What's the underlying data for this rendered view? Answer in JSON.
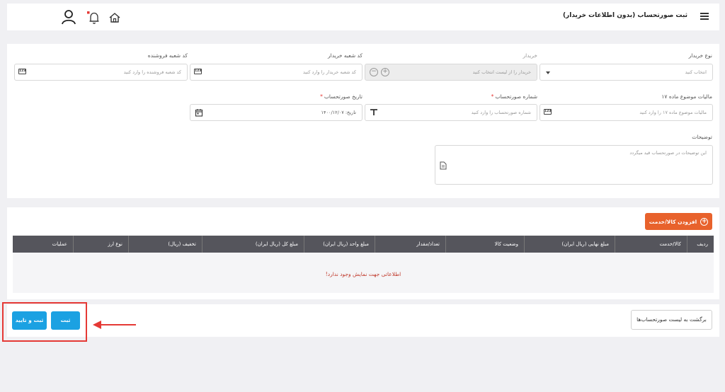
{
  "header": {
    "title": "ثبت صورتحساب (بدون اطلاعات خریدار)",
    "notification_dot_color": "#e53935"
  },
  "form": {
    "buyer_type": {
      "label": "نوع خریدار",
      "placeholder": "انتخاب کنید"
    },
    "buyer": {
      "label": "خریدار",
      "placeholder": "خریدار را از لیست انتخاب کنید"
    },
    "buyer_branch": {
      "label": "کد شعبه خریدار",
      "placeholder": "کد شعبه خریدار را وارد کنید"
    },
    "seller_branch": {
      "label": "کد شعبه فروشنده",
      "placeholder": "کد شعبه فروشنده را وارد کنید"
    },
    "tax_article17": {
      "label": "مالیات موضوع ماده ۱۷",
      "placeholder": "مالیات موضوع ماده ۱۷ را وارد کنید"
    },
    "invoice_number": {
      "label": "شماره صورتحساب",
      "required_mark": "*",
      "placeholder": "شماره صورتحساب را وارد کنید"
    },
    "invoice_date": {
      "label": "تاریخ صورتحساب",
      "required_mark": "*",
      "value": "تاریخ: ۱۴۰۰/۱۲/۰۷"
    },
    "description": {
      "label": "توضیحات",
      "placeholder": "این توضیحات در صورتحساب قید میگردد"
    }
  },
  "items": {
    "add_button": "افزودن کالا/خدمت",
    "columns": [
      "ردیف",
      "کالا/خدمت",
      "مبلغ نهایی (ریال ایران)",
      "وضعیت کالا",
      "تعداد/مقدار",
      "مبلغ واحد (ریال ایران)",
      "مبلغ کل (ریال ایران)",
      "تخفیف (ریال)",
      "نوع ارز",
      "عملیات"
    ],
    "empty_message": "اطلاعاتی جهت نمایش وجود ندارد!"
  },
  "footer": {
    "back_button": "برگشت به لیست صورتحساب‌ها",
    "save_button": "ثبت",
    "save_confirm_button": "ثبت و تایید"
  },
  "colors": {
    "accent_orange": "#e8622c",
    "accent_blue": "#1ba1e2",
    "table_header": "#55555c",
    "highlight_red": "#e53935"
  }
}
